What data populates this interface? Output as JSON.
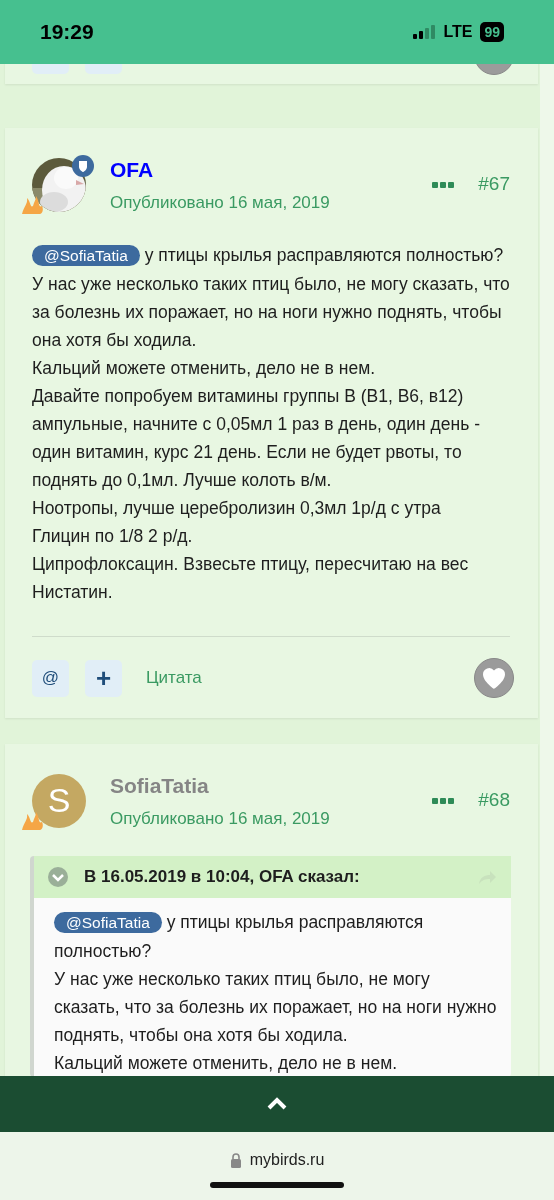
{
  "status_bar": {
    "time": "19:29",
    "network": "LTE",
    "battery": "99"
  },
  "posts": [
    {
      "author": "OFA",
      "color": "#0000ff",
      "moderator": true,
      "published": "Опубликовано 16 мая, 2019",
      "number": "#67",
      "paragraphs": [
        {
          "mention": "@SofiaTatia",
          "text": "у птицы крылья расправляются полностью?"
        },
        {
          "text": "У нас уже несколько таких птиц было, не могу сказать, что за болезнь их поражает, но на ноги нужно поднять, чтобы она хотя бы ходила."
        },
        {
          "text": "Кальций можете отменить, дело не в нем."
        },
        {
          "text": "Давайте попробуем витамины группы В (В1, В6, в12) ампульные, начните с 0,05мл 1 раз в день, один день - один витамин, курс 21 день. Если не будет рвоты, то поднять до 0,1мл. Лучше колоть в/м."
        },
        {
          "text": "Ноотропы, лучше церебролизин 0,3мл 1р/д с утра"
        },
        {
          "text": "Глицин по 1/8 2 р/д."
        },
        {
          "text": "Ципрофлоксацин. Взвесьте птицу, пересчитаю на вес"
        },
        {
          "text": "Нистатин."
        }
      ],
      "footer": {
        "mention_button": "@",
        "add_button": "+",
        "quote_link": "Цитата"
      }
    },
    {
      "author": "SofiaTatia",
      "color": "#858585",
      "moderator": false,
      "avatar": {
        "kind": "letter",
        "letter": "S",
        "color": "#c4a862"
      },
      "published": "Опубликовано 16 мая, 2019",
      "number": "#68",
      "quote": {
        "header": "В 16.05.2019 в 10:04, OFA сказал:",
        "paragraphs": [
          {
            "mention": "@SofiaTatia",
            "text": "у птицы крылья расправляются полностью?"
          },
          {
            "text": "У нас уже несколько таких птиц было, не могу сказать, что за болезнь их поражает, но на ноги нужно поднять, чтобы она хотя бы ходила."
          },
          {
            "text": "Кальций можете отменить, дело не в нем."
          }
        ]
      }
    }
  ],
  "browser": {
    "address": "mybirds.ru"
  }
}
